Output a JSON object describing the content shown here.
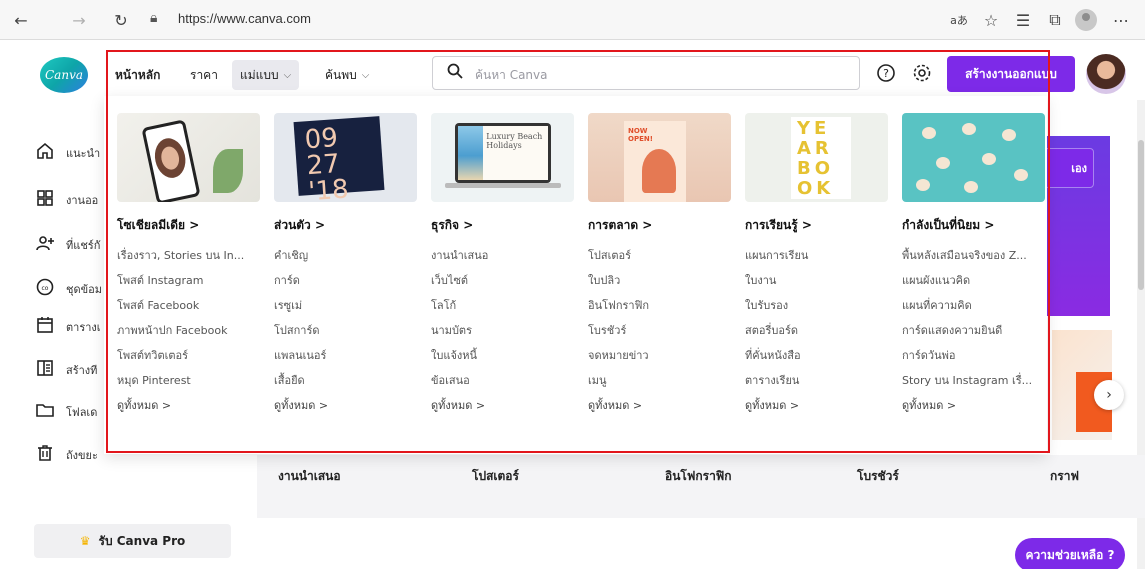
{
  "browser": {
    "url": "https://www.canva.com",
    "read_aloud": "aあ"
  },
  "header": {
    "logo_text": "Canva",
    "nav": [
      {
        "label": "หน้าหลัก"
      },
      {
        "label": "ราคา"
      },
      {
        "label": "แม่แบบ"
      },
      {
        "label": "ค้นพบ"
      }
    ],
    "search_placeholder": "ค้นหา Canva",
    "create_button": "สร้างงานออกแบบ"
  },
  "sidebar": {
    "items": [
      {
        "label": "แนะนำ",
        "icon": "home-icon"
      },
      {
        "label": "งานออ",
        "icon": "grid-icon"
      },
      {
        "label": "ที่แชร์กั",
        "icon": "share-people-icon"
      },
      {
        "label": "ชุดข้อม",
        "icon": "brand-kit-icon"
      },
      {
        "label": "ตารางเ",
        "icon": "calendar-icon"
      },
      {
        "label": "สร้างที",
        "icon": "apps-icon"
      },
      {
        "label": "โฟลเด",
        "icon": "folder-icon"
      },
      {
        "label": "ถังขยะ",
        "icon": "trash-icon"
      }
    ],
    "pro_button": "รับ Canva Pro"
  },
  "dropdown": {
    "columns": [
      {
        "heading": "โซเชียลมีเดีย >",
        "links": [
          "เรื่องราว, Stories บน In...",
          "โพสต์ Instagram",
          "โพสต์ Facebook",
          "ภาพหน้าปก Facebook",
          "โพสต์ทวิตเตอร์",
          "หมุด Pinterest"
        ],
        "see_all": "ดูทั้งหมด >"
      },
      {
        "heading": "ส่วนตัว >",
        "links": [
          "คำเชิญ",
          "การ์ด",
          "เรซูเม่",
          "โปสการ์ด",
          "แพลนเนอร์",
          "เสื้อยืด"
        ],
        "see_all": "ดูทั้งหมด >",
        "thumb_text": "09 27 '18"
      },
      {
        "heading": "ธุรกิจ >",
        "links": [
          "งานนำเสนอ",
          "เว็บไซต์",
          "โลโก้",
          "นามบัตร",
          "ใบแจ้งหนี้",
          "ข้อเสนอ"
        ],
        "see_all": "ดูทั้งหมด >",
        "thumb_text": "Luxury Beach Holidays"
      },
      {
        "heading": "การตลาด >",
        "links": [
          "โปสเตอร์",
          "ใบปลิว",
          "อินโฟกราฟิก",
          "โบรชัวร์",
          "จดหมายข่าว",
          "เมนู"
        ],
        "see_all": "ดูทั้งหมด >"
      },
      {
        "heading": "การเรียนรู้ >",
        "links": [
          "แผนการเรียน",
          "ใบงาน",
          "ใบรับรอง",
          "สตอรี่บอร์ด",
          "ที่คั่นหนังสือ",
          "ตารางเรียน"
        ],
        "see_all": "ดูทั้งหมด >",
        "thumb_text": "YEARBOOK"
      },
      {
        "heading": "กำลังเป็นที่นิยม >",
        "links": [
          "พื้นหลังเสมือนจริงของ Z...",
          "แผนผังแนวคิด",
          "แผนที่ความคิด",
          "การ์ดแสดงความยินดี",
          "การ์ดวันพ่อ",
          "Story บน Instagram เรื่..."
        ],
        "see_all": "ดูทั้งหมด >"
      }
    ]
  },
  "categories": [
    "งานนำเสนอ",
    "โปสเตอร์",
    "อินโฟกราฟิก",
    "โบรชัวร์",
    "กราฟ"
  ],
  "right_button_partial": "เอง",
  "help_button": "ความช่วยเหลือ ?",
  "colors": {
    "brand_purple": "#7d2ae8",
    "highlight_frame": "#e2161c"
  }
}
